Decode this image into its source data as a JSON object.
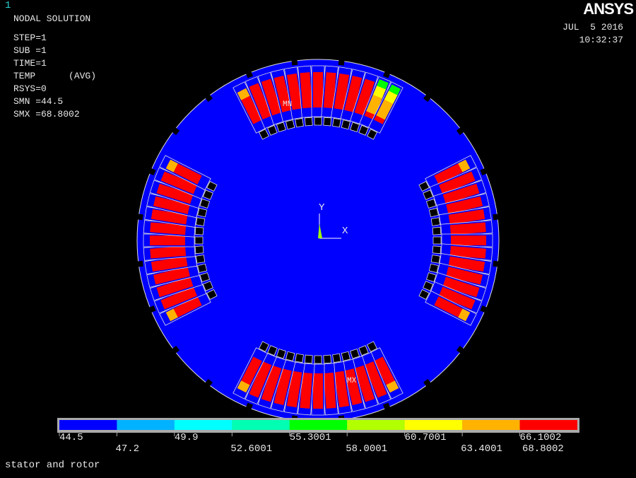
{
  "window_number": "1",
  "logo": "ANSYS",
  "date": "JUL  5 2016",
  "time": "10:32:37",
  "info": {
    "title": "NODAL SOLUTION",
    "lines": [
      "STEP=1",
      "SUB =1",
      "TIME=1",
      "TEMP      (AVG)",
      "RSYS=0",
      "SMN =44.5",
      "SMX =68.8002"
    ]
  },
  "markers": {
    "min": "MN",
    "max": "MX"
  },
  "axes": {
    "x": "X",
    "y": "Y"
  },
  "legend": {
    "colors": [
      "#0000ff",
      "#00b2ff",
      "#00ffff",
      "#00ffb2",
      "#00ff00",
      "#b2ff00",
      "#ffff00",
      "#ffb200",
      "#ff0000"
    ],
    "labels": [
      "44.5",
      "47.2",
      "49.9",
      "52.6001",
      "55.3001",
      "58.0001",
      "60.7001",
      "63.4001",
      "66.1002",
      "68.8002"
    ]
  },
  "caption": "stator and rotor"
}
